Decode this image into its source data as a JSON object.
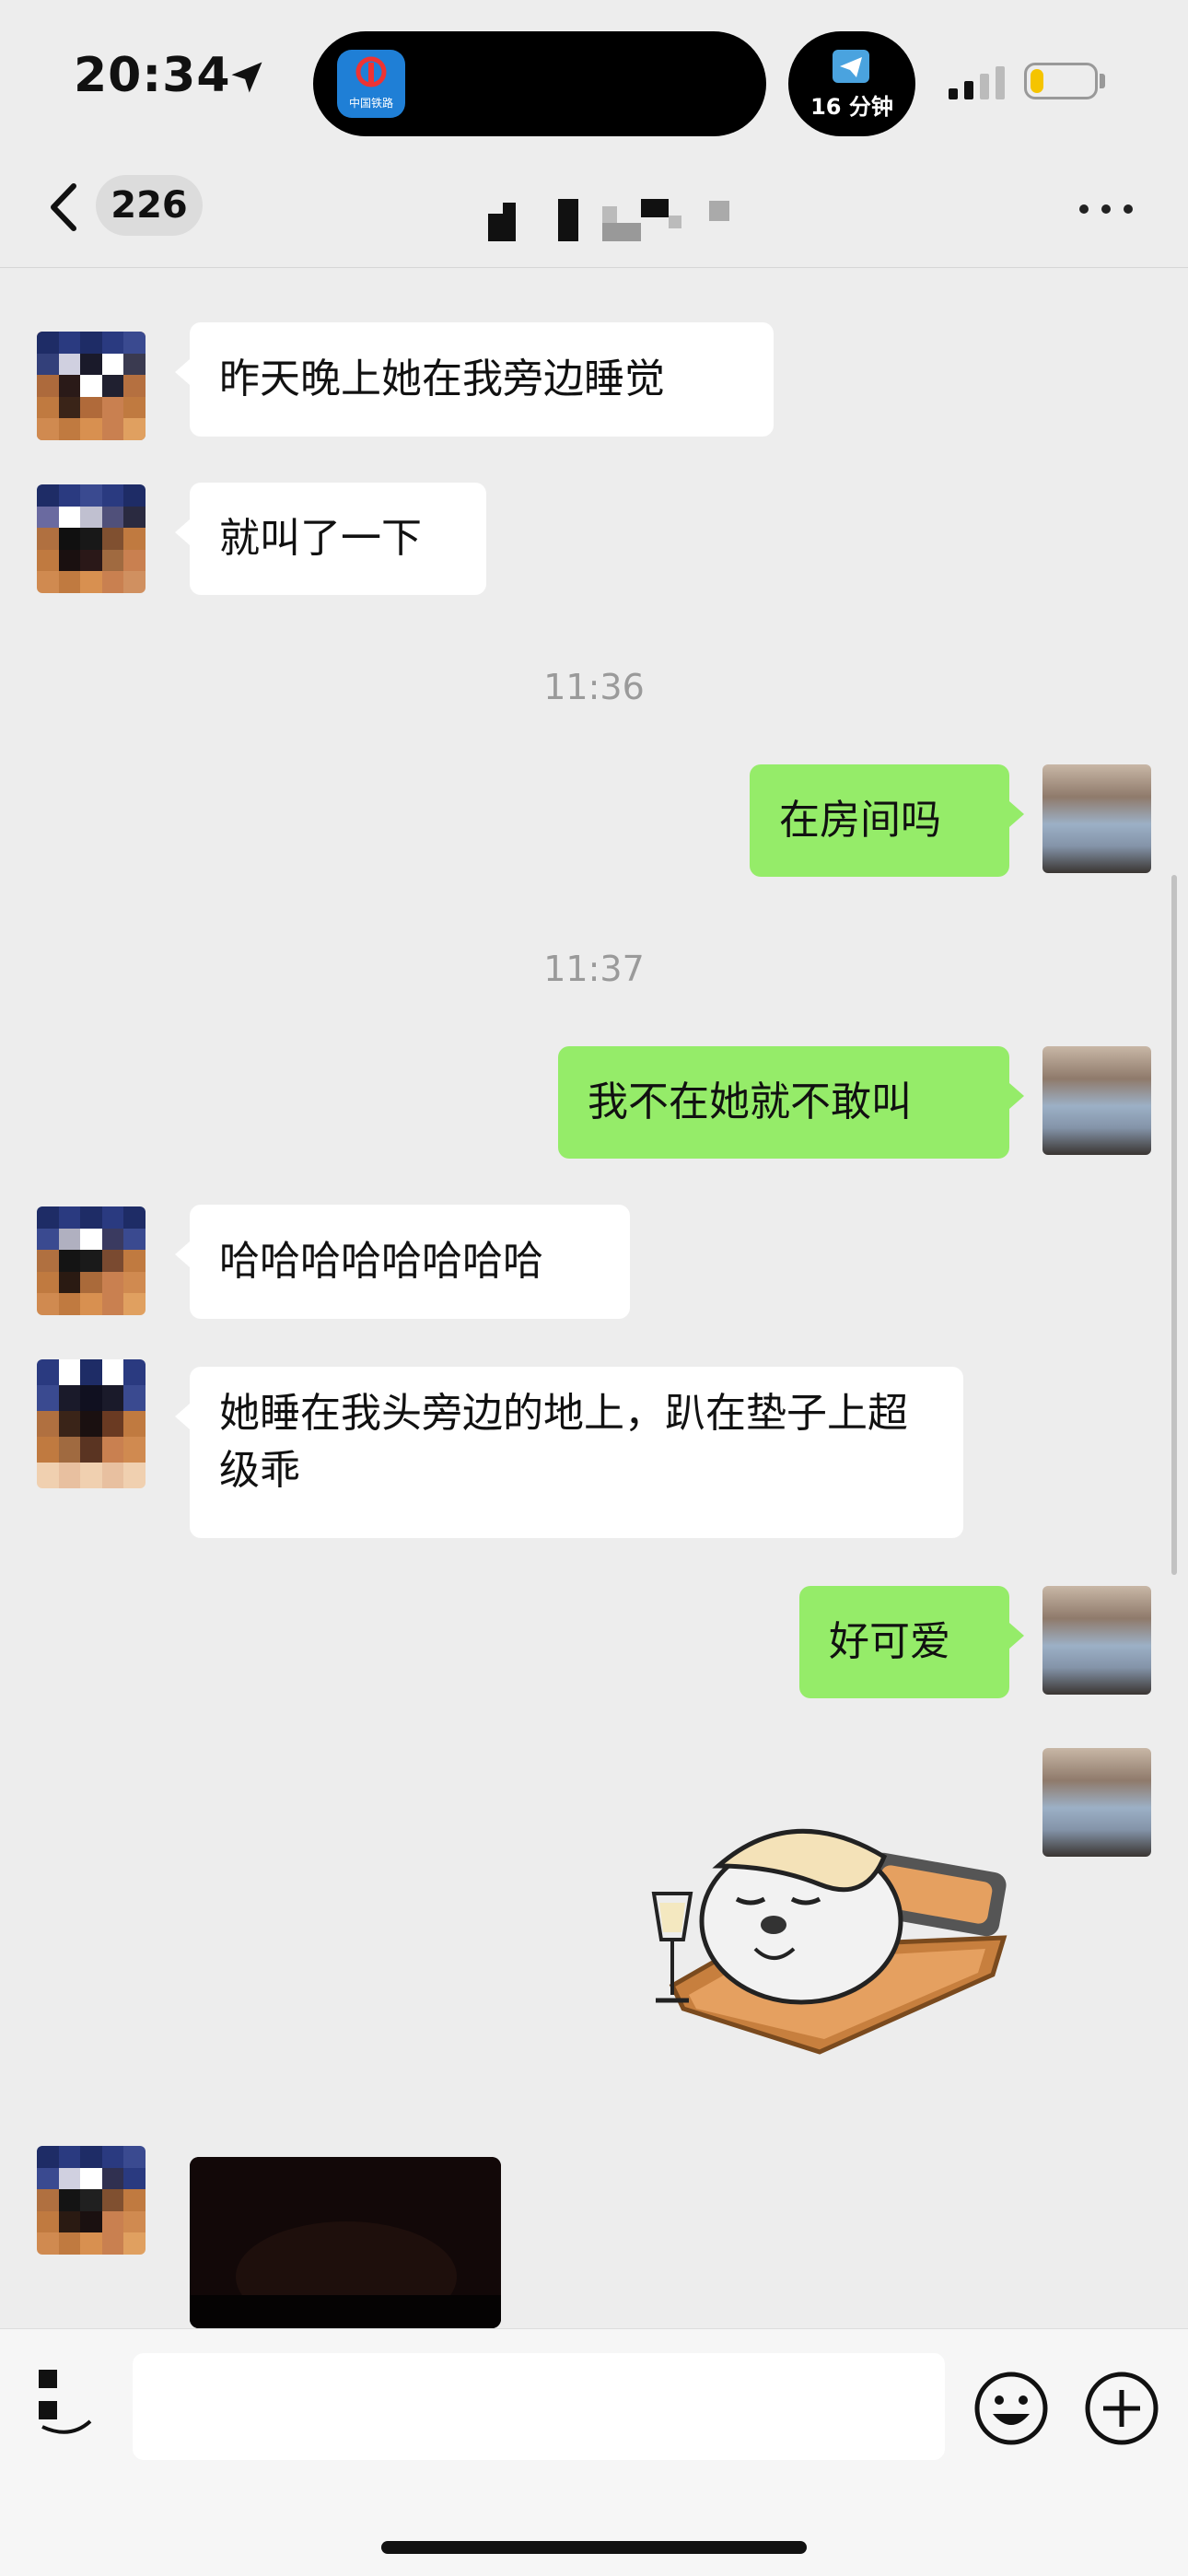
{
  "status_bar": {
    "time": "20:34",
    "app_icon_label": "中国铁路",
    "timer_text": "16 分钟",
    "battery_level": 0.2,
    "colors": {
      "battery": "#f5c400",
      "app_icon": "#1f7fd6"
    }
  },
  "nav": {
    "unread_count": "226",
    "icons": {
      "back": "chevron-left-icon",
      "more": "more-horizontal-icon"
    }
  },
  "messages": [
    {
      "side": "left",
      "text": "昨天晚上她在我旁边睡觉"
    },
    {
      "side": "left",
      "text": "就叫了一下"
    },
    {
      "type": "timestamp",
      "text": "11:36"
    },
    {
      "side": "right",
      "text": "在房间吗"
    },
    {
      "type": "timestamp",
      "text": "11:37"
    },
    {
      "side": "right",
      "text": "我不在她就不敢叫"
    },
    {
      "side": "left",
      "text": "哈哈哈哈哈哈哈哈"
    },
    {
      "side": "left",
      "text": "她睡在我头旁边的地上，趴在垫子上超级乖"
    },
    {
      "side": "right",
      "text": "好可爱"
    },
    {
      "side": "right",
      "type": "sticker",
      "description": "sleeping-seal-sticker"
    },
    {
      "side": "left",
      "type": "image"
    }
  ],
  "input_bar": {
    "value": "",
    "icons": {
      "voice": "voice-icon",
      "emoji": "emoji-icon",
      "plus": "plus-icon"
    }
  },
  "colors": {
    "background": "#ededed",
    "outgoing_bubble": "#95ec69",
    "incoming_bubble": "#ffffff",
    "timestamp_text": "#9a9a9a"
  }
}
